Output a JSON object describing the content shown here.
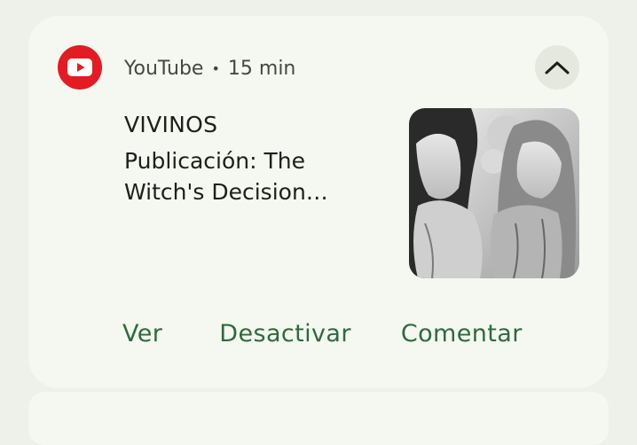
{
  "notification": {
    "app_name": "YouTube",
    "separator": "•",
    "time": "15 min",
    "title": "VIVINOS",
    "body": "Publicación: The Witch's Decision…",
    "app_icon": "youtube-logo-icon",
    "expand_icon": "chevron-up-icon",
    "thumbnail": "manga-illustration-thumbnail",
    "actions": [
      {
        "label": "Ver"
      },
      {
        "label": "Desactivar"
      },
      {
        "label": "Comentar"
      }
    ]
  },
  "colors": {
    "background": "#eef1ea",
    "card": "#f4f8f1",
    "youtube_red": "#e31b23",
    "action_text": "#2f6a3d",
    "primary_text": "#1c1f1a",
    "secondary_text": "#44483f"
  }
}
